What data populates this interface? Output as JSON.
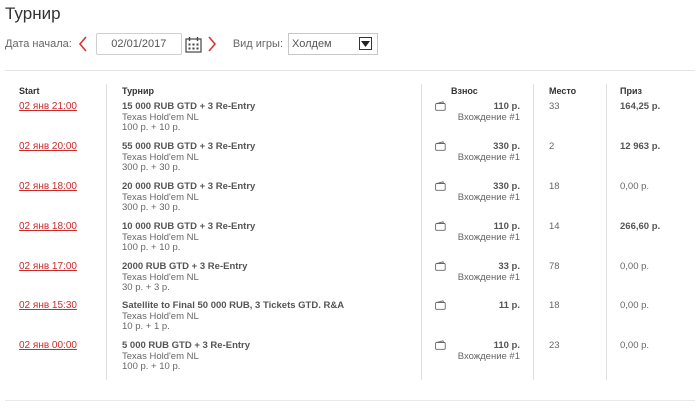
{
  "page": {
    "title": "Турнир"
  },
  "filters": {
    "date_label": "Дата начала:",
    "date_value": "02/01/2017",
    "game_label": "Вид игры:",
    "game_value": "Холдем"
  },
  "table": {
    "headers": {
      "start": "Start",
      "tournament": "Турнир",
      "buyin": "Взнос",
      "place": "Место",
      "prize": "Приз"
    },
    "rows": [
      {
        "start": "02 янв 21:00",
        "name": "15 000 RUB GTD + 3 Re-Entry",
        "game": "Texas Hold'em NL",
        "buyin_detail": "100 р. + 10 р.",
        "fee": "110 р.",
        "entry": "Вхождение #1",
        "place": "33",
        "prize": "164,25 р.",
        "prize_won": true
      },
      {
        "start": "02 янв 20:00",
        "name": "55 000 RUB GTD + 3 Re-Entry",
        "game": "Texas Hold'em NL",
        "buyin_detail": "300 р. + 30 р.",
        "fee": "330 р.",
        "entry": "Вхождение #1",
        "place": "2",
        "prize": "12 963 р.",
        "prize_won": true
      },
      {
        "start": "02 янв 18:00",
        "name": "20 000 RUB GTD + 3 Re-Entry",
        "game": "Texas Hold'em NL",
        "buyin_detail": "300 р. + 30 р.",
        "fee": "330 р.",
        "entry": "Вхождение #1",
        "place": "18",
        "prize": "0,00 р.",
        "prize_won": false
      },
      {
        "start": "02 янв 18:00",
        "name": "10 000 RUB GTD + 3 Re-Entry",
        "game": "Texas Hold'em NL",
        "buyin_detail": "100 р. + 10 р.",
        "fee": "110 р.",
        "entry": "Вхождение #1",
        "place": "14",
        "prize": "266,60 р.",
        "prize_won": true
      },
      {
        "start": "02 янв 17:00",
        "name": "2000 RUB GTD + 3 Re-Entry",
        "game": "Texas Hold'em NL",
        "buyin_detail": "30 р. + 3 р.",
        "fee": "33 р.",
        "entry": "Вхождение #1",
        "place": "78",
        "prize": "0,00 р.",
        "prize_won": false
      },
      {
        "start": "02 янв 15:30",
        "name": "Satellite to Final 50 000 RUB, 3 Tickets GTD. R&A",
        "game": "Texas Hold'em NL",
        "buyin_detail": "10 р. + 1 р.",
        "fee": "11 р.",
        "entry": "",
        "place": "18",
        "prize": "0,00 р.",
        "prize_won": false
      },
      {
        "start": "02 янв 00:00",
        "name": "5 000 RUB GTD + 3 Re-Entry",
        "game": "Texas Hold'em NL",
        "buyin_detail": "100 р. + 10 р.",
        "fee": "110 р.",
        "entry": "Вхождение #1",
        "place": "23",
        "prize": "0,00 р.",
        "prize_won": false
      }
    ]
  },
  "icons": {
    "prev": "chevron-left-icon",
    "next": "chevron-right-icon",
    "calendar": "calendar-icon",
    "dropdown": "dropdown-arrow-icon",
    "wallet": "wallet-icon"
  },
  "colors": {
    "accent": "#cc2a2a",
    "text": "#555555",
    "border": "#e0e0e0"
  }
}
